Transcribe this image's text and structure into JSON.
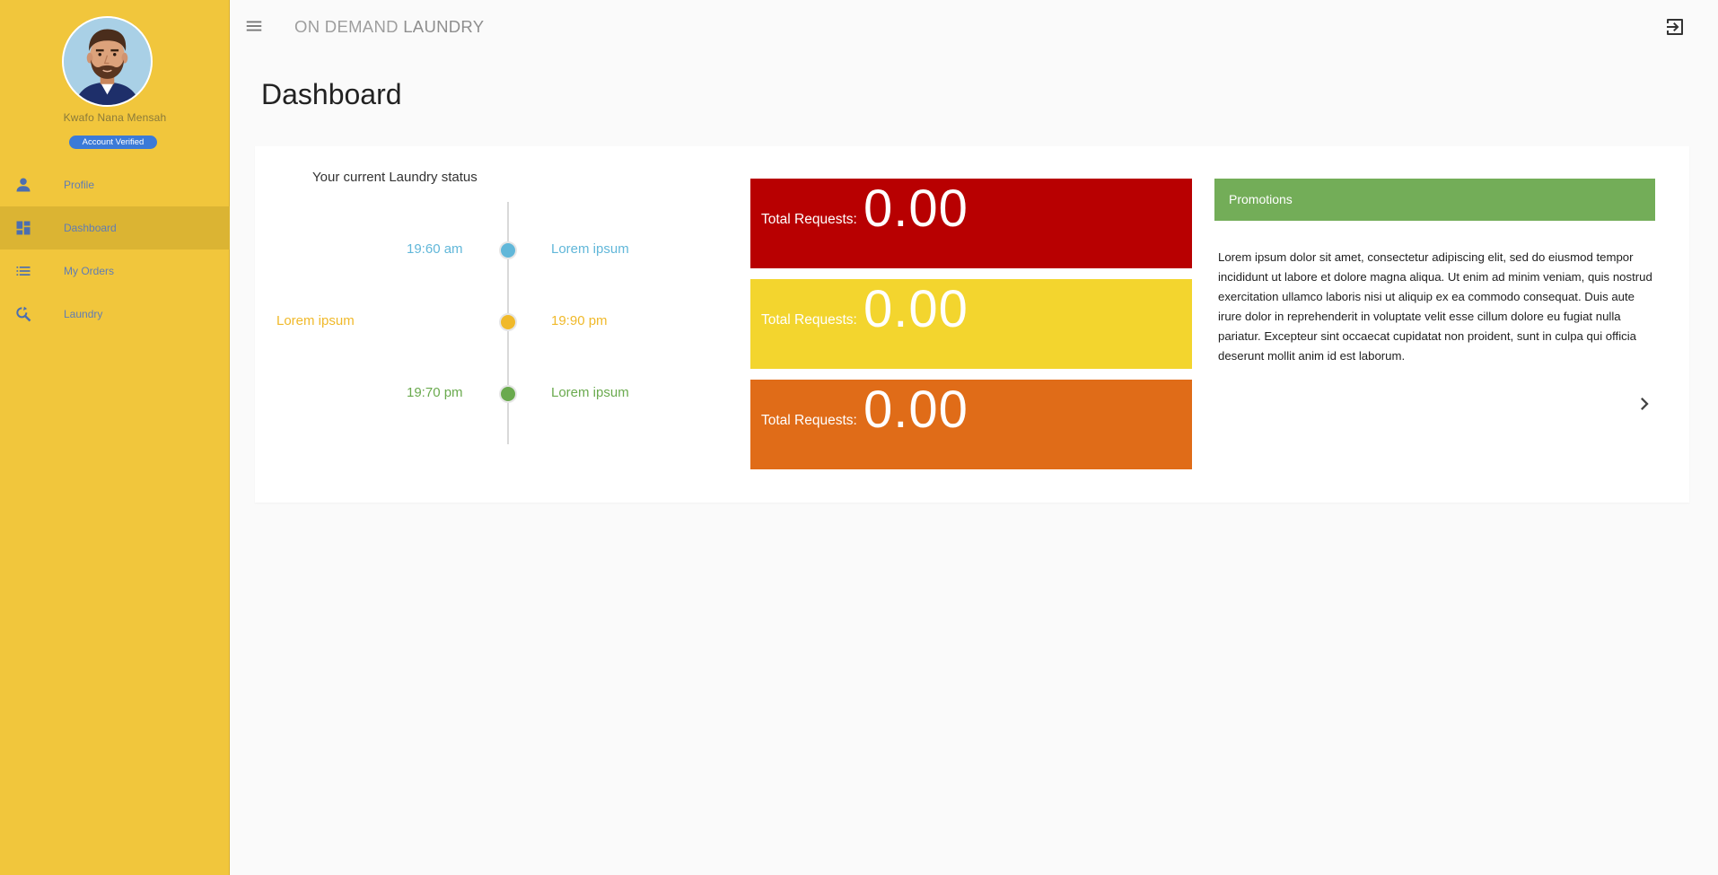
{
  "app": {
    "title_light": "ON DEMAND",
    "title_strong": "LAUNDRY"
  },
  "user": {
    "name": "Kwafo Nana Mensah",
    "badge": "Account Verified"
  },
  "sidebar": {
    "items": [
      {
        "label": "Profile",
        "icon": "person-icon",
        "active": false
      },
      {
        "label": "Dashboard",
        "icon": "dashboard-icon",
        "active": true
      },
      {
        "label": "My Orders",
        "icon": "list-icon",
        "active": false
      },
      {
        "label": "Laundry",
        "icon": "search-refresh-icon",
        "active": false
      }
    ]
  },
  "page": {
    "title": "Dashboard"
  },
  "timeline": {
    "heading": "Your current Laundry status",
    "events": [
      {
        "left_text": "19:60 am",
        "right_text": "Lorem ipsum",
        "color": "#61b7d9"
      },
      {
        "left_text": "Lorem ipsum",
        "right_text": "19:90 pm",
        "color": "#f0b92a"
      },
      {
        "left_text": "19:70 pm",
        "right_text": "Lorem ipsum",
        "color": "#6aaa4e"
      }
    ]
  },
  "stats": [
    {
      "label": "Total Requests:",
      "value": "0.00",
      "color": "#b80001"
    },
    {
      "label": "Total Requests:",
      "value": "0.00",
      "color": "#f3d52e"
    },
    {
      "label": "Total Requests:",
      "value": "0.00",
      "color": "#e06c18"
    }
  ],
  "promotions": {
    "title": "Promotions",
    "text": "Lorem ipsum dolor sit amet, consectetur adipiscing elit, sed do eiusmod tempor incididunt ut labore et dolore magna aliqua. Ut enim ad minim veniam, quis nostrud exercitation ullamco laboris nisi ut aliquip ex ea commodo consequat. Duis aute irure dolor in reprehenderit in voluptate velit esse cillum dolore eu fugiat nulla pariatur. Excepteur sint occaecat cupidatat non proident, sunt in culpa qui officia deserunt mollit anim id est laborum.",
    "header_color": "#73ad58"
  },
  "colors": {
    "sidebar_bg": "#f1c63c",
    "sidebar_active": "#dbb433",
    "nav_text": "#5f7cb4",
    "badge_bg": "#3b7ad8"
  }
}
